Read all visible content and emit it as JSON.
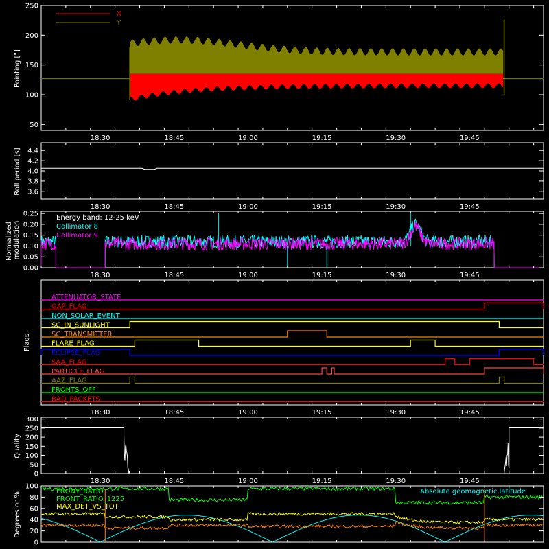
{
  "time_axis": {
    "start": "18:18",
    "end": "20:00",
    "tick_labels": [
      "18:30",
      "18:45",
      "19:00",
      "19:15",
      "19:30",
      "19:45"
    ]
  },
  "chart_data": [
    {
      "type": "area",
      "ylabel": "Pointing [\"]",
      "ylim": [
        40,
        250
      ],
      "yticks": [
        50,
        100,
        150,
        200,
        250
      ],
      "legend_placement": "top-left",
      "series": [
        {
          "name": "X",
          "color": "#ff0000",
          "x_start": "18:36",
          "x_end": "19:52",
          "low_start": 92,
          "low_settled": 115,
          "high": 135
        },
        {
          "name": "Y",
          "color": "#808000",
          "x_start": "18:36",
          "x_end": "19:52",
          "low": 135,
          "high_peak": 195,
          "high_settled": 175,
          "spike_at_end": 228
        }
      ],
      "reference_line": {
        "value": 127,
        "color": "#808000"
      }
    },
    {
      "type": "line",
      "ylabel": "Roll period [s]",
      "ylim": [
        3.45,
        4.55
      ],
      "yticks": [
        3.6,
        3.8,
        4.0,
        4.2,
        4.4
      ],
      "tick_labels": [
        "3.6",
        "3.8",
        "4.0",
        "4.2",
        "4.4"
      ],
      "series": [
        {
          "color": "#ffffff",
          "value": 4.05,
          "dip_time": "18:40",
          "dip_value": 4.03
        }
      ]
    },
    {
      "type": "line",
      "ylabel": "Normalized modulation",
      "ylim": [
        0,
        0.26
      ],
      "yticks": [
        0.0,
        0.05,
        0.1,
        0.15,
        0.2,
        0.25
      ],
      "tick_labels": [
        "0.00",
        "0.05",
        "0.10",
        "0.15",
        "0.20",
        "0.25"
      ],
      "annotation": "Energy band: 12-25 keV",
      "series": [
        {
          "name": "Collimator 8",
          "color": "#00ffff",
          "segments": [
            [
              "18:18",
              "18:21"
            ],
            [
              "18:31",
              "19:50"
            ]
          ],
          "level": 0.12,
          "spikes": [
            {
              "x": "18:54",
              "y": 0.25
            },
            {
              "x": "19:33",
              "y": 0.26
            }
          ]
        },
        {
          "name": "Collimator 9",
          "color": "#ff00ff",
          "segments": [
            [
              "18:18",
              "18:21"
            ],
            [
              "18:31",
              "19:50"
            ]
          ],
          "level": 0.11
        }
      ],
      "flare_bump": {
        "x": "19:34",
        "y": 0.2
      }
    },
    {
      "type": "line",
      "ylabel": "Flags",
      "flags": [
        {
          "name": "ATTENUATOR_STATE",
          "color": "#ff00ff",
          "high": []
        },
        {
          "name": "GAP_FLAG",
          "color": "#ff0000",
          "high": [
            [
              "19:48",
              "20:00"
            ]
          ]
        },
        {
          "name": "NON_SOLAR_EVENT",
          "color": "#00ffff",
          "high": []
        },
        {
          "name": "SC_IN_SUNLIGHT",
          "color": "#ffff00",
          "high": [
            [
              "18:36",
              "19:51"
            ]
          ]
        },
        {
          "name": "SC_TRANSMITTER",
          "color": "#ff8000",
          "high": [
            [
              "19:08",
              "19:16"
            ]
          ]
        },
        {
          "name": "FLARE_FLAG",
          "color": "#ffff00",
          "high": [
            [
              "18:37",
              "18:50"
            ],
            [
              "19:33",
              "19:38"
            ]
          ]
        },
        {
          "name": "ECLIPSE_FLAG",
          "color": "#0000ff",
          "high": [
            [
              "18:18",
              "18:36"
            ],
            [
              "19:51",
              "20:00"
            ]
          ]
        },
        {
          "name": "SAA_FLAG",
          "color": "#ff0000",
          "high": [
            [
              "19:40",
              "19:42"
            ],
            [
              "19:45",
              "19:58"
            ]
          ]
        },
        {
          "name": "PARTICLE_FLAG",
          "color": "#ff4040",
          "high": [
            [
              "19:15",
              "19:16"
            ],
            [
              "19:17",
              "19:17.5"
            ],
            [
              "19:48",
              "20:00"
            ]
          ]
        },
        {
          "name": "AAZ_FLAG",
          "color": "#808000",
          "high": [
            [
              "18:36",
              "18:37"
            ],
            [
              "19:51",
              "19:52"
            ]
          ]
        },
        {
          "name": "FRONTS_OFF",
          "color": "#00ff00",
          "high": []
        },
        {
          "name": "BAD_PACKETS",
          "color": "#ff0000",
          "high": []
        }
      ]
    },
    {
      "type": "line",
      "ylabel": "Quality",
      "ylim": [
        0,
        310
      ],
      "yticks": [
        0,
        50,
        100,
        150,
        200,
        250,
        300
      ],
      "series": [
        {
          "color": "#ffffff",
          "value_high": 255,
          "segments_high": [
            [
              "18:18",
              "18:36"
            ],
            [
              "19:52",
              "20:00"
            ]
          ]
        }
      ]
    },
    {
      "type": "line",
      "ylabel": "Degrees or %",
      "ylim": [
        0,
        100
      ],
      "yticks": [
        0,
        20,
        40,
        60,
        80,
        100
      ],
      "annotation": "Absolute geomagnetic latitude",
      "series": [
        {
          "name": "FRONT_RATIO",
          "color": "#00ff00",
          "levels": [
            95,
            95,
            75,
            95,
            70,
            80
          ]
        },
        {
          "name": "FRONT_RATIO_1225",
          "color": "#00ff00"
        },
        {
          "name": "MAX_DET_VS_TOT",
          "color": "#ffff00",
          "levels": [
            50,
            45,
            40,
            50,
            35,
            40
          ]
        },
        {
          "name": "",
          "color": "#ff8000",
          "levels": [
            30,
            25,
            30,
            28,
            25,
            30
          ]
        },
        {
          "name": "Absolute geomagnetic latitude",
          "color": "#00ffff",
          "minima": [
            "18:30",
            "19:05",
            "19:40"
          ],
          "maxima": [
            "18:43",
            "19:22",
            "19:57"
          ],
          "max_value": 48
        }
      ]
    }
  ]
}
